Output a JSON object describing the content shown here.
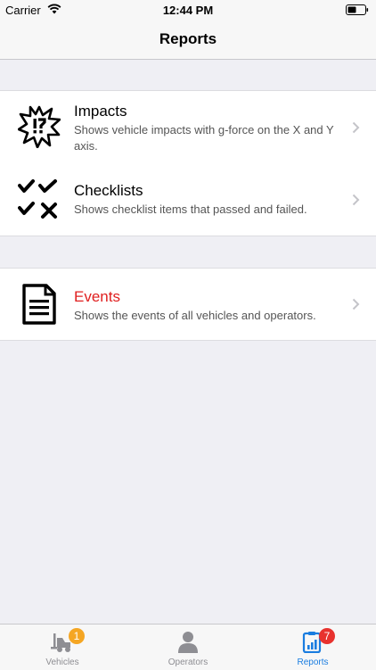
{
  "status_bar": {
    "carrier": "Carrier",
    "time": "12:44 PM"
  },
  "nav": {
    "title": "Reports"
  },
  "reports": [
    {
      "title": "Impacts",
      "subtitle": "Shows vehicle impacts with g-force on the X and Y axis.",
      "icon": "impact-icon"
    },
    {
      "title": "Checklists",
      "subtitle": "Shows checklist items that passed and failed.",
      "icon": "checklist-icon"
    },
    {
      "title": "Events",
      "subtitle": "Shows the events of all vehicles and operators.",
      "icon": "document-icon",
      "title_color": "#e02020"
    }
  ],
  "tab_bar": {
    "tabs": [
      {
        "label": "Vehicles",
        "badge": "1",
        "badge_color": "#f5a623",
        "icon": "forklift-icon"
      },
      {
        "label": "Operators",
        "icon": "person-icon"
      },
      {
        "label": "Reports",
        "badge": "7",
        "badge_color": "#e8322e",
        "icon": "report-chart-icon",
        "active": true
      }
    ],
    "active_color": "#1a7de0"
  }
}
